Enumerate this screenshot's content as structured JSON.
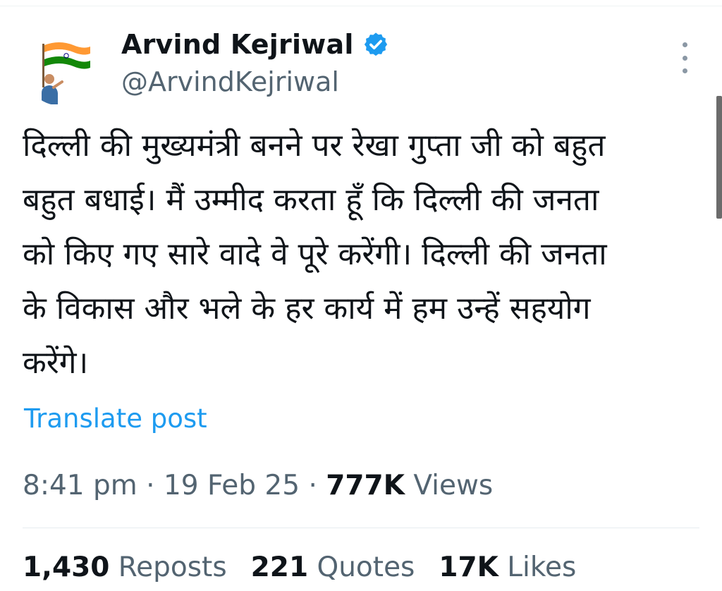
{
  "author": {
    "display_name": "Arvind Kejriwal",
    "handle": "@ArvindKejriwal",
    "verified_color": "#1d9bf0"
  },
  "post": {
    "lines": [
      "दिल्ली की मुख्यमंत्री बनने पर रेखा गुप्ता जी को बहुत",
      "बहुत बधाई। मैं उम्मीद करता हूँ कि दिल्ली की जनता",
      "को किए गए सारे वादे वे पूरे करेंगी। दिल्ली की जनता",
      "के विकास और भले के हर कार्य में हम उन्हें सहयोग",
      "करेंगे।"
    ]
  },
  "translate_label": "Translate post",
  "meta": {
    "time": "8:41 pm",
    "separator": "·",
    "date": "19 Feb 25",
    "views_count": "777K",
    "views_label": "Views"
  },
  "stats": {
    "reposts_count": "1,430",
    "reposts_label": "Reposts",
    "quotes_count": "221",
    "quotes_label": "Quotes",
    "likes_count": "17K",
    "likes_label": "Likes"
  },
  "colors": {
    "link": "#1d9bf0",
    "secondary_text": "#536471",
    "primary_text": "#0f1419"
  },
  "icons": {
    "verified": "verified-badge-icon",
    "more": "more-vertical-icon"
  }
}
